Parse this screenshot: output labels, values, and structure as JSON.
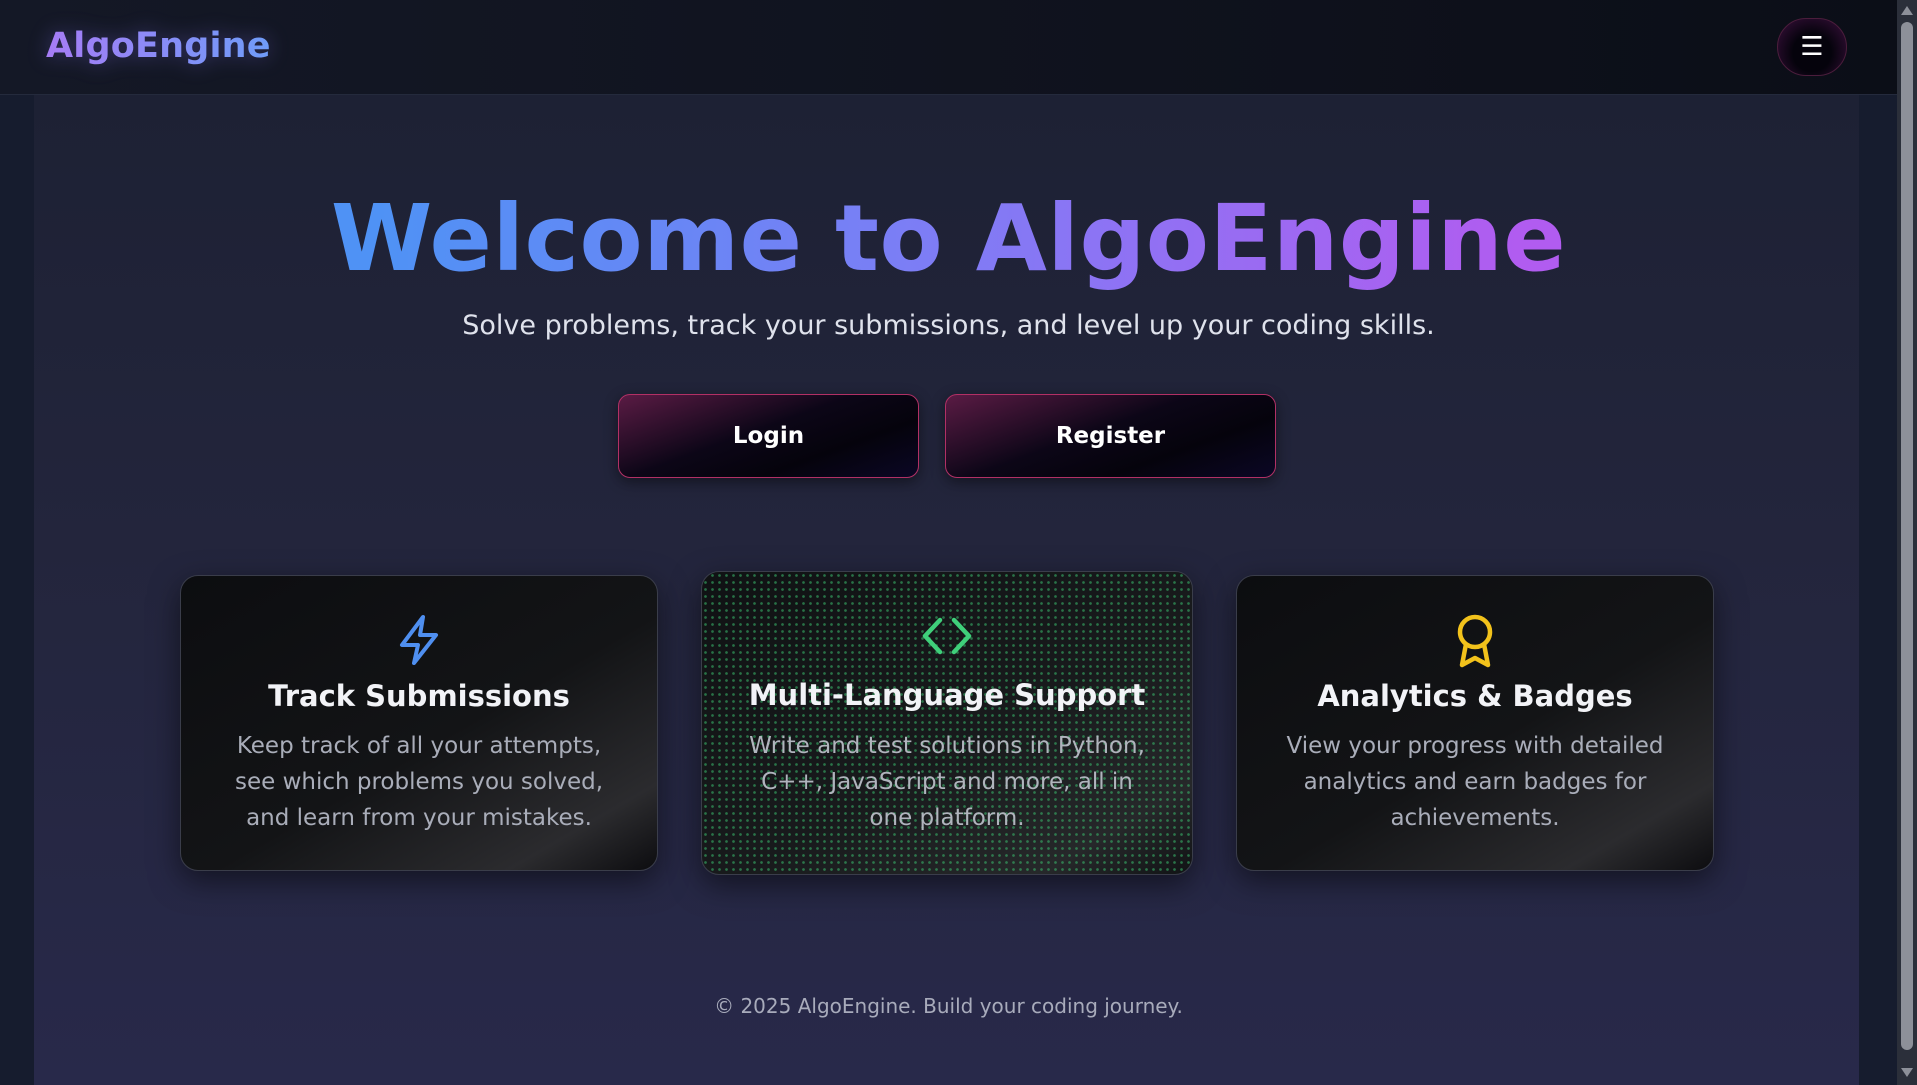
{
  "header": {
    "logo": "AlgoEngine",
    "menu_icon": "hamburger-menu-icon",
    "menu_glyph": "☰"
  },
  "hero": {
    "title": "Welcome to AlgoEngine",
    "subtitle": "Solve problems, track your submissions, and level up your coding skills.",
    "login_label": "Login",
    "register_label": "Register"
  },
  "features": [
    {
      "icon": "lightning-bolt-icon",
      "icon_color": "#4f8ff0",
      "title": "Track Submissions",
      "description": "Keep track of all your attempts, see which problems you solved, and learn from your mistakes."
    },
    {
      "icon": "code-brackets-icon",
      "icon_color": "#3fcf7a",
      "title": "Multi-Language Support",
      "description": "Write and test solutions in Python, C++, JavaScript and more, all in one platform."
    },
    {
      "icon": "award-badge-icon",
      "icon_color": "#f2c21b",
      "title": "Analytics & Badges",
      "description": "View your progress with detailed analytics and earn badges for achievements."
    }
  ],
  "footer": {
    "text": "© 2025 AlgoEngine. Build your coding journey."
  }
}
